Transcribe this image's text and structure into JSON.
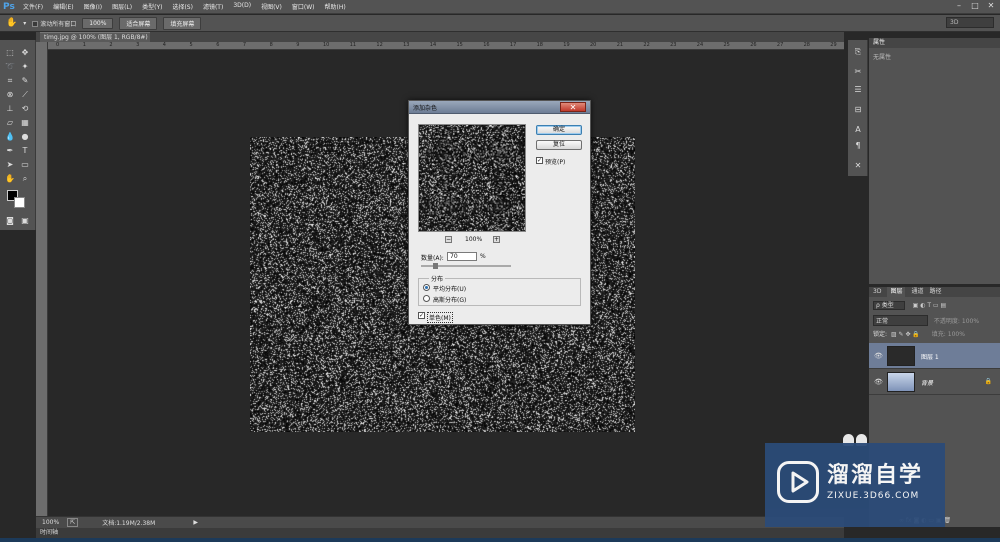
{
  "app": {
    "logo": "Ps"
  },
  "menu": [
    "文件(F)",
    "编辑(E)",
    "图像(I)",
    "图层(L)",
    "类型(Y)",
    "选择(S)",
    "滤镜(T)",
    "3D(D)",
    "视图(V)",
    "窗口(W)",
    "帮助(H)"
  ],
  "window_controls": {
    "minimize": "–",
    "maximize": "□",
    "close": "✕"
  },
  "options_bar": {
    "scroll_all_windows": "滚动所有窗口",
    "zoom_100": "100%",
    "fit_screen": "适合屏幕",
    "fill_screen": "填充屏幕",
    "workspace": "3D"
  },
  "document_tab": {
    "label": "timg.jpg @ 100% (图层 1, RGB/8#) *",
    "close": "×"
  },
  "ruler_numbers": [
    "0",
    "1",
    "2",
    "3",
    "4",
    "5",
    "6",
    "7",
    "8",
    "9",
    "10",
    "11",
    "12",
    "13",
    "14",
    "15",
    "16",
    "17",
    "18",
    "19",
    "20",
    "21",
    "22",
    "23",
    "24",
    "25",
    "26",
    "27",
    "28",
    "29"
  ],
  "status_bar": {
    "zoom": "100%",
    "doc_info": "文档:1.19M/2.38M",
    "arrow": "▶"
  },
  "timeline_label": "时间轴",
  "properties_panel": {
    "title": "属性",
    "empty_text": "无属性"
  },
  "layers_panel": {
    "tabs": [
      "3D",
      "图层",
      "通道",
      "路径"
    ],
    "active_tab": "图层",
    "filter_label": "ρ 类型",
    "blend_mode": "正常",
    "opacity_label": "不透明度:",
    "opacity_value": "100%",
    "lock_label": "锁定:",
    "fill_label": "填充:",
    "fill_value": "100%",
    "layers": [
      {
        "name": "图层 1",
        "selected": true
      },
      {
        "name": "背景",
        "locked": true
      }
    ],
    "footer_icons": "∞ fx ◙ ◐ ▭ ▣ 🗑"
  },
  "dialog": {
    "title": "添加杂色",
    "close": "✕",
    "ok": "确定",
    "reset": "复位",
    "preview_label": "预览(P)",
    "preview_checked": true,
    "zoom_minus": "−",
    "zoom_plus": "+",
    "zoom_value": "100%",
    "amount_label": "数量(A):",
    "amount_value": "70",
    "amount_unit": "%",
    "distribution_title": "分布",
    "uniform_label": "平均分布(U)",
    "gaussian_label": "高斯分布(G)",
    "uniform_selected": true,
    "monochromatic_label": "单色(M)",
    "monochromatic_checked": true
  },
  "watermark": {
    "title": "溜溜自学",
    "url": "ZIXUE.3D66.COM"
  },
  "colors": {
    "accent": "#4fa3e8",
    "selected_layer": "#6e7d98",
    "watermark_bg": "#2b4b78"
  }
}
